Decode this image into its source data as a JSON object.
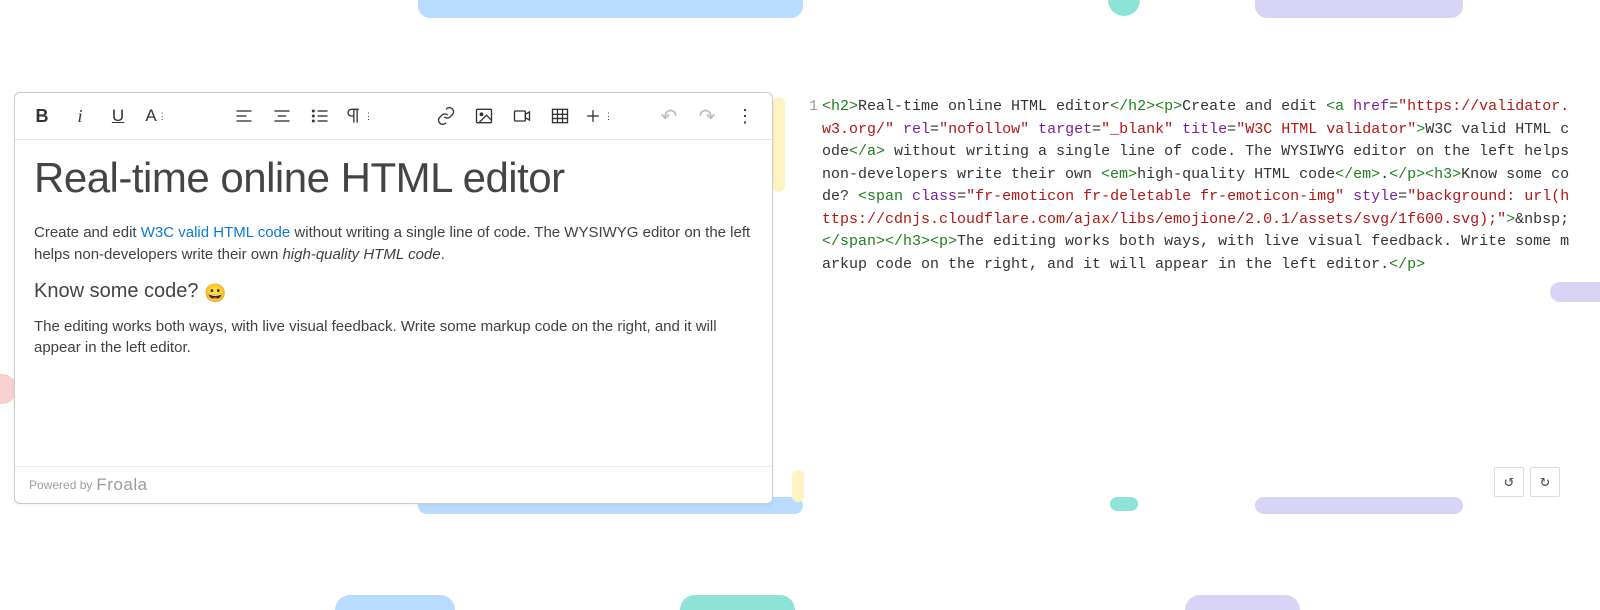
{
  "gutter_line": "1",
  "toolbar": {
    "bold": "B",
    "italic": "i",
    "text_style": "A",
    "undo": "↶",
    "redo": "↷",
    "more": "⋮"
  },
  "content": {
    "h2": "Real-time online HTML editor",
    "p1_a": "Create and edit ",
    "p1_link": "W3C valid HTML code",
    "p1_b": " without writing a single line of code. The WYSIWYG editor on the left helps non-developers write their own ",
    "p1_em": "high-quality HTML code",
    "p1_c": ".",
    "h3": "Know some code? ",
    "emoji": "😀",
    "p2": "The editing works both ways, with live visual feedback. Write some markup code on the right, and it will appear in the left editor."
  },
  "footer": {
    "powered": "Powered by",
    "brand": "Froala"
  },
  "code_controls": {
    "undo": "↺",
    "redo": "↻"
  },
  "src": {
    "t01": "<h2>",
    "t02": "Real-time online HTML editor",
    "t03": "</h2><p>",
    "t04": "Create and edit ",
    "t05": "<a",
    "a_href_k": "href",
    "a_href_v": "\"https://validator.w3.org/\"",
    "a_rel_k": "rel",
    "a_rel_v": "\"nofollow\"",
    "a_tgt_k": "target",
    "a_tgt_v": "\"_blank\"",
    "a_ttl_k": "title",
    "a_ttl_v": "\"W3C HTML validator\"",
    "t06": ">",
    "t07": "W3C valid HTML code",
    "t08": "</a>",
    "t09": " without writing a single line of code. The WYSIWYG editor on the left helps non-developers write their own ",
    "t10": "<em>",
    "t11": "high-quality HTML code",
    "t12": "</em>",
    "t13": ".",
    "t14": "</p><h3>",
    "t15": "Know some code? ",
    "t16": "<span",
    "span_cls_k": "class",
    "span_cls_v": "\"fr-emoticon fr-deletable fr-emoticon-img\"",
    "span_sty_k": "style",
    "span_sty_v": "\"background: url(https://cdnjs.cloudflare.com/ajax/libs/emojione/2.0.1/assets/svg/1f600.svg);\"",
    "t17": ">",
    "t18": "&nbsp;",
    "t19": "</span></h3><p>",
    "t20": "The editing works both ways, with live visual feedback. Write some markup code on the right, and it will appear in the left editor.",
    "t21": "</p>"
  }
}
